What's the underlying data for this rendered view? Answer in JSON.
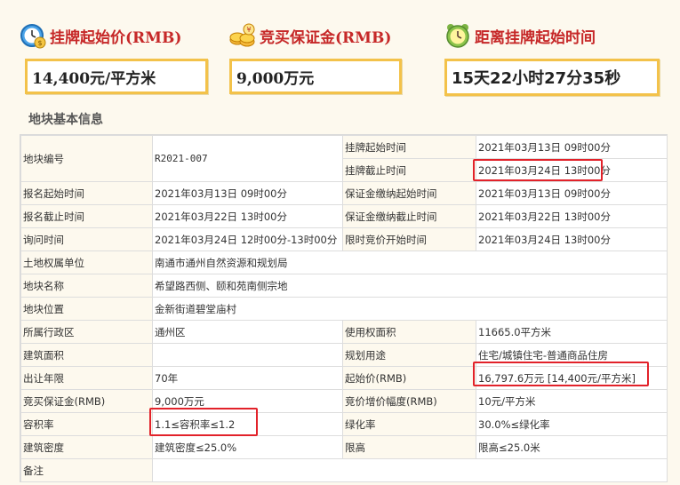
{
  "header": {
    "start_price": {
      "label": "挂牌起始价(RMB)",
      "value": "14,400元/平方米",
      "icon": "clock-dollar-icon"
    },
    "deposit": {
      "label": "竞买保证金(RMB)",
      "value": "9,000万元",
      "icon": "coins-icon"
    },
    "countdown": {
      "label": "距离挂牌起始时间",
      "value": "15天22小时27分35秒",
      "icon": "alarm-clock-icon"
    }
  },
  "section_title": "地块基本信息",
  "table": {
    "parcel_no_label": "地块编号",
    "parcel_no": "R2021-007",
    "list_start_label": "挂牌起始时间",
    "list_start": "2021年03月13日 09时00分",
    "list_end_label": "挂牌截止时间",
    "list_end": "2021年03月24日 13时00分",
    "reg_start_label": "报名起始时间",
    "reg_start": "2021年03月13日 09时00分",
    "dep_start_label": "保证金缴纳起始时间",
    "dep_start": "2021年03月13日 09时00分",
    "reg_end_label": "报名截止时间",
    "reg_end": "2021年03月22日 13时00分",
    "dep_end_label": "保证金缴纳截止时间",
    "dep_end": "2021年03月22日 13时00分",
    "inquiry_label": "询问时间",
    "inquiry": "2021年03月24日 12时00分-13时00分",
    "timed_bid_label": "限时竞价开始时间",
    "timed_bid": "2021年03月24日 13时00分",
    "owner_label": "土地权属单位",
    "owner": "南通市通州自然资源和规划局",
    "name_label": "地块名称",
    "name": "希望路西侧、颐和苑南侧宗地",
    "location_label": "地块位置",
    "location": "金新街道碧堂庙村",
    "district_label": "所属行政区",
    "district": "通州区",
    "use_area_label": "使用权面积",
    "use_area": "11665.0平方米",
    "build_area_label": "建筑面积",
    "build_area": "",
    "purpose_label": "规划用途",
    "purpose": "住宅/城镇住宅-普通商品住房",
    "term_label": "出让年限",
    "term": "70年",
    "start_price_label": "起始价(RMB)",
    "start_price": "16,797.6万元 [14,400元/平方米]",
    "deposit_label": "竞买保证金(RMB)",
    "deposit": "9,000万元",
    "increment_label": "竞价增价幅度(RMB)",
    "increment": "10元/平方米",
    "far_label": "容积率",
    "far": "1.1≤容积率≤1.2",
    "green_label": "绿化率",
    "green": "30.0%≤绿化率",
    "density_label": "建筑密度",
    "density": "建筑密度≤25.0%",
    "height_label": "限高",
    "height": "限高≤25.0米",
    "remark_label": "备注",
    "remark": ""
  },
  "colors": {
    "accent_red": "#c62828",
    "box_border": "#f3c24a",
    "highlight": "#e2222a",
    "page_bg": "#fdf9ee"
  }
}
